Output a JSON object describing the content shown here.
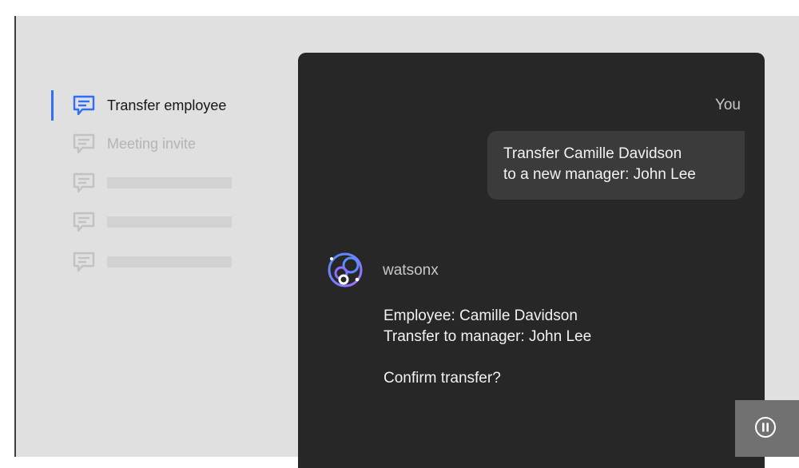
{
  "sidebar": {
    "items": [
      {
        "label": "Transfer employee",
        "state": "active",
        "icon": "chat-icon"
      },
      {
        "label": "Meeting invite",
        "state": "muted",
        "icon": "chat-icon"
      },
      {
        "label": "",
        "state": "placeholder",
        "icon": "chat-icon"
      },
      {
        "label": "",
        "state": "placeholder",
        "icon": "chat-icon"
      },
      {
        "label": "",
        "state": "placeholder",
        "icon": "chat-icon"
      }
    ]
  },
  "chat": {
    "user_label": "You",
    "user_message_line1": "Transfer Camille Davidson",
    "user_message_line2": "to a new manager: John Lee",
    "bot_name": "watsonx",
    "bot_line1": "Employee: Camille Davidson",
    "bot_line2": "Transfer to manager: John Lee",
    "bot_line3": "Confirm transfer?"
  },
  "controls": {
    "pause_icon": "pause-icon"
  },
  "colors": {
    "accent": "#2f6ef6",
    "panel": "#272727",
    "bubble": "#3b3b3b",
    "background": "#e0e0e0"
  }
}
